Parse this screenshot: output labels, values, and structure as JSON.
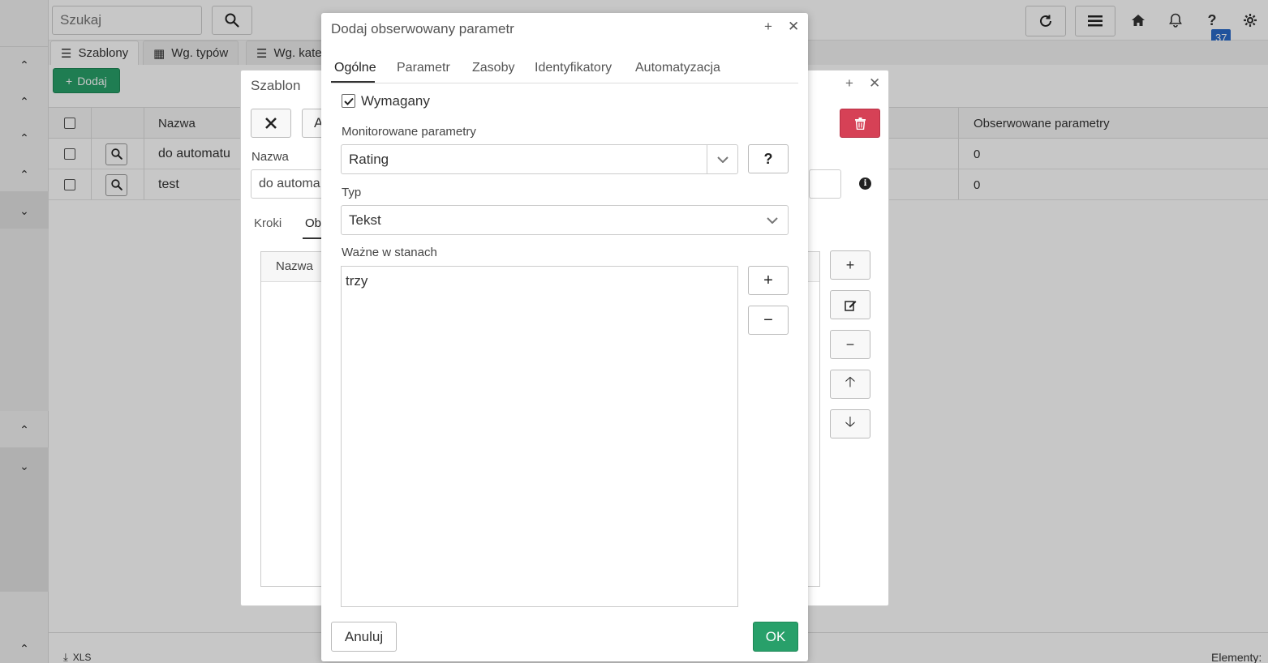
{
  "topbar": {
    "search_placeholder": "Szukaj",
    "notification_count": "37"
  },
  "view_tabs": [
    {
      "label": "Szablony",
      "icon": "list-icon"
    },
    {
      "label": "Wg. typów",
      "icon": "grid-icon"
    },
    {
      "label": "Wg. kate",
      "icon": "list-icon"
    }
  ],
  "toolbar": {
    "add_label": "Dodaj"
  },
  "grid": {
    "headers": {
      "name": "Nazwa",
      "observed": "Obserwowane parametry"
    },
    "rows": [
      {
        "name": "do automatu",
        "observed": "0"
      },
      {
        "name": "test",
        "observed": "0"
      }
    ]
  },
  "footer": {
    "export_label": "XLS",
    "elements_label": "Elementy:"
  },
  "template_dialog": {
    "title": "Szablon",
    "partial_button": "A",
    "name_label": "Nazwa",
    "name_value": "do automa",
    "tabs": [
      "Kroki",
      "Ob"
    ],
    "inner_header": "Nazwa"
  },
  "dialog": {
    "title": "Dodaj obserwowany parametr",
    "tabs": [
      "Ogólne",
      "Parametr",
      "Zasoby",
      "Identyfikatory",
      "Automatyzacja"
    ],
    "required_label": "Wymagany",
    "required_checked": true,
    "monitored_label": "Monitorowane parametry",
    "monitored_value": "Rating",
    "type_label": "Typ",
    "type_value": "Tekst",
    "states_label": "Ważne w stanach",
    "states": [
      "trzy"
    ],
    "cancel_label": "Anuluj",
    "ok_label": "OK",
    "help_label": "?"
  },
  "colors": {
    "accent_green": "#28a06a",
    "danger_red": "#d64156",
    "badge_blue": "#2a6ac8"
  }
}
